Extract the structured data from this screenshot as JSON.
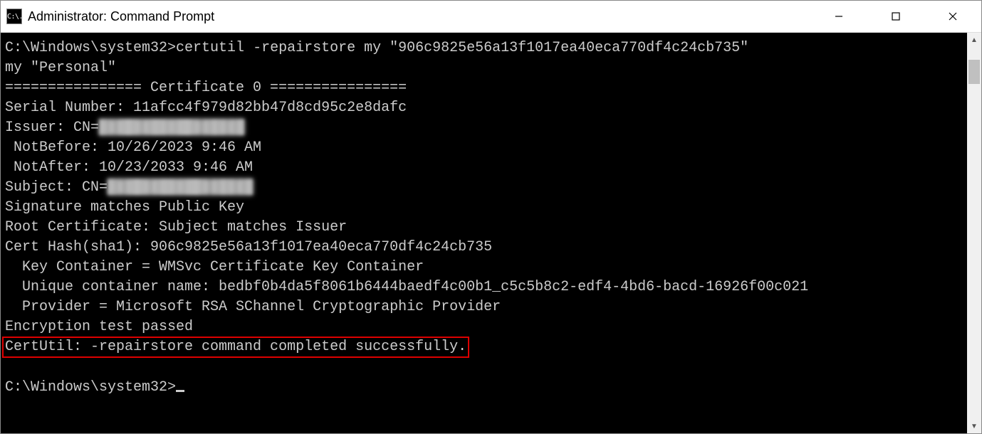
{
  "window": {
    "icon_text": "C:\\.",
    "title": "Administrator: Command Prompt"
  },
  "console": {
    "line1_prompt": "C:\\Windows\\system32>",
    "line1_cmd": "certutil -repairstore my \"906c9825e56a13f1017ea40eca770df4c24cb735\"",
    "line2": "my \"Personal\"",
    "line3": "================ Certificate 0 ================",
    "line4": "Serial Number: 11afcc4f979d82bb47d8cd95c2e8dafc",
    "line5_prefix": "Issuer: CN=",
    "line5_redacted": "█████████████████",
    "line6": " NotBefore: 10/26/2023 9:46 AM",
    "line7": " NotAfter: 10/23/2033 9:46 AM",
    "line8_prefix": "Subject: CN=",
    "line8_redacted": "█████████████████",
    "line9": "Signature matches Public Key",
    "line10": "Root Certificate: Subject matches Issuer",
    "line11": "Cert Hash(sha1): 906c9825e56a13f1017ea40eca770df4c24cb735",
    "line12": "  Key Container = WMSvc Certificate Key Container",
    "line13": "  Unique container name: bedbf0b4da5f8061b6444baedf4c00b1_c5c5b8c2-edf4-4bd6-bacd-16926f00c021",
    "line14": "  Provider = Microsoft RSA SChannel Cryptographic Provider",
    "line15": "Encryption test passed",
    "line16_highlight": "CertUtil: -repairstore command completed successfully.",
    "line_blank": "",
    "line18_prompt": "C:\\Windows\\system32>"
  }
}
